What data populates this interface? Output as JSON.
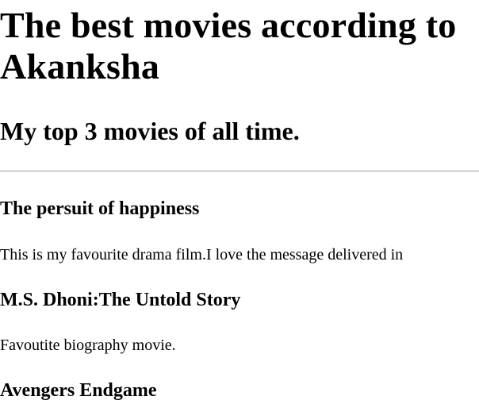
{
  "page": {
    "title": "The best movies according to Akanksha",
    "subtitle": "My top 3 movies of all time."
  },
  "movies": [
    {
      "title": "The persuit of happiness",
      "description": "This is my favourite drama film.I love the message delivered in"
    },
    {
      "title": "M.S. Dhoni:The Untold Story",
      "description": "Favoutite biography movie."
    },
    {
      "title": "Avengers Endgame"
    }
  ]
}
